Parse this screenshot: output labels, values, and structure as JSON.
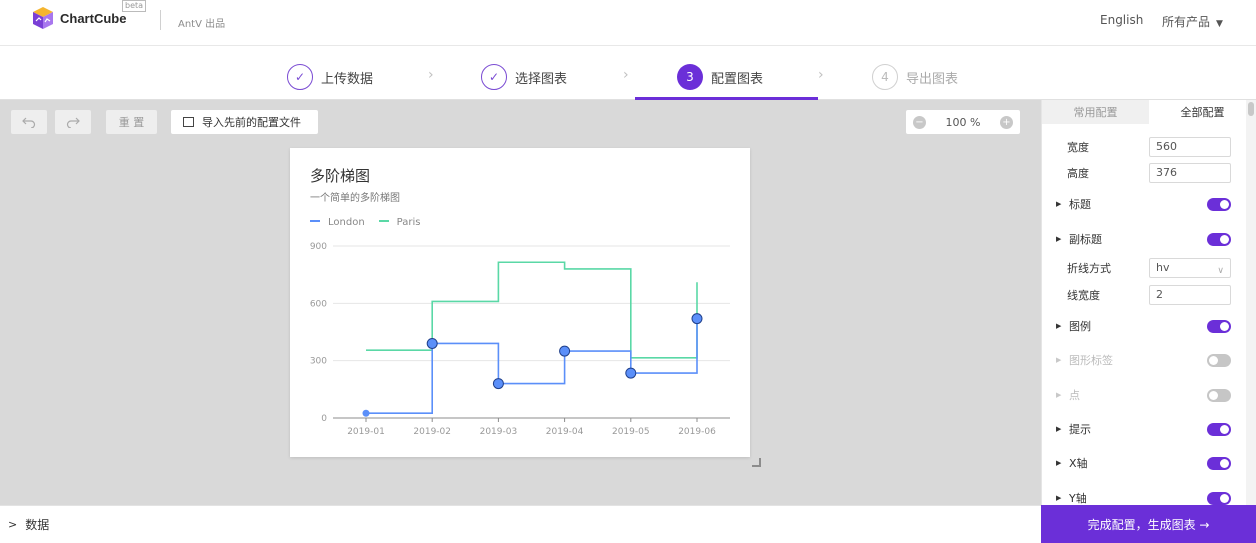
{
  "header": {
    "brand": "ChartCube",
    "beta": "beta",
    "by": "AntV 出品",
    "language": "English",
    "products": "所有产品"
  },
  "steps": [
    {
      "label": "上传数据",
      "state": "done",
      "marker": "✓"
    },
    {
      "label": "选择图表",
      "state": "done",
      "marker": "✓"
    },
    {
      "label": "配置图表",
      "state": "active",
      "marker": "3"
    },
    {
      "label": "导出图表",
      "state": "todo",
      "marker": "4"
    }
  ],
  "toolbar": {
    "undo_icon": "undo-icon",
    "redo_icon": "redo-icon",
    "reset_label": "重 置",
    "import_label": "导入先前的配置文件",
    "zoom_out": "−",
    "zoom_value": "100 %",
    "zoom_in": "+"
  },
  "chart": {
    "title": "多阶梯图",
    "subtitle": "一个简单的多阶梯图"
  },
  "chart_data": {
    "type": "line",
    "step": "hv",
    "x": [
      "2019-01",
      "2019-02",
      "2019-03",
      "2019-04",
      "2019-05",
      "2019-06"
    ],
    "series": [
      {
        "name": "London",
        "values": [
          25,
          390,
          180,
          350,
          235,
          520
        ],
        "color": "#5b8ff9",
        "points": true
      },
      {
        "name": "Paris",
        "values": [
          355,
          610,
          815,
          780,
          315,
          710
        ],
        "color": "#5ad8a6",
        "points": false
      }
    ],
    "ylim": [
      0,
      900
    ],
    "yticks": [
      0,
      300,
      600,
      900
    ],
    "grid": true,
    "legend": "top-left"
  },
  "data_panel": {
    "label": "数据"
  },
  "config": {
    "tabs": [
      {
        "label": "常用配置",
        "active": false
      },
      {
        "label": "全部配置",
        "active": true
      }
    ],
    "width_label": "宽度",
    "width_value": "560",
    "height_label": "高度",
    "height_value": "376",
    "title_label": "标题",
    "subtitle_label": "副标题",
    "step_label": "折线方式",
    "step_value": "hv",
    "linewidth_label": "线宽度",
    "linewidth_value": "2",
    "legend_label": "图例",
    "label_label": "图形标签",
    "point_label": "点",
    "tooltip_label": "提示",
    "xaxis_label": "X轴",
    "yaxis_label": "Y轴",
    "toggles": {
      "title": true,
      "subtitle": true,
      "legend": true,
      "label": false,
      "point": false,
      "tooltip": true,
      "xaxis": true,
      "yaxis": true
    }
  },
  "finish": {
    "label": "完成配置，生成图表 →"
  }
}
